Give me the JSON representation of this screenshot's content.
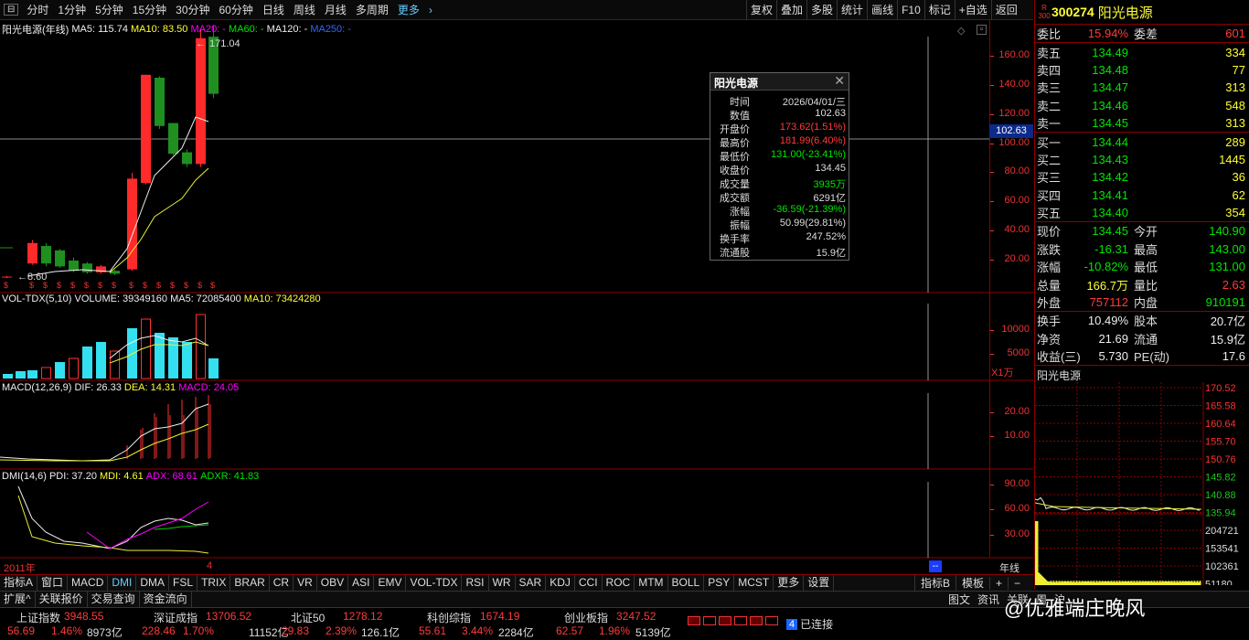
{
  "toolbar": {
    "periods": [
      "分时",
      "1分钟",
      "5分钟",
      "15分钟",
      "30分钟",
      "60分钟",
      "日线",
      "周线",
      "月线",
      "多周期"
    ],
    "more": "更多",
    "right": [
      "复权",
      "叠加",
      "多股",
      "统计",
      "画线",
      "F10",
      "标记",
      "+自选",
      "返回"
    ]
  },
  "main": {
    "title": "阳光电源(年线)",
    "ma5": "MA5: 115.74",
    "ma10": "MA10: 83.50",
    "ma20": "MA20: -",
    "ma60": "MA60: -",
    "ma120": "MA120: -",
    "ma250": "MA250: -",
    "high_label": "171.04",
    "low_label": "8.60",
    "axis": [
      "160.00",
      "140.00",
      "120.00",
      "100.00",
      "80.00",
      "60.00",
      "40.00",
      "20.00"
    ],
    "crosshair_value": "102.63"
  },
  "vol": {
    "title": "VOL-TDX(5,10)",
    "volume": "VOLUME: 39349160",
    "ma5": "MA5: 72085400",
    "ma10": "MA10: 73424280",
    "axis": [
      "10000",
      "5000"
    ],
    "unit": "X1万"
  },
  "macd": {
    "title": "MACD(12,26,9)",
    "dif": "DIF: 26.33",
    "dea": "DEA: 14.31",
    "macd": "MACD: 24.05",
    "axis": [
      "20.00",
      "10.00"
    ]
  },
  "dmi": {
    "title": "DMI(14,6)",
    "pdi": "PDI: 37.20",
    "mdi": "MDI: 4.61",
    "adx": "ADX: 68.61",
    "adxr": "ADXR: 41.83",
    "axis": [
      "90.00",
      "60.00",
      "30.00"
    ],
    "year": "2011年",
    "last_year": "4",
    "period_label": "年线"
  },
  "tooltip": {
    "title": "阳光电源",
    "rows": [
      [
        "时间",
        "2026/04/01/三"
      ],
      [
        "数值",
        "102.63"
      ],
      [
        "开盘价",
        "173.62(1.51%)"
      ],
      [
        "最高价",
        "181.99(6.40%)"
      ],
      [
        "最低价",
        "131.00(-23.41%)"
      ],
      [
        "收盘价",
        "134.45"
      ],
      [
        "成交量",
        "3935万"
      ],
      [
        "成交额",
        "6291亿"
      ],
      [
        "涨幅",
        "-36.59(-21.39%)"
      ],
      [
        "振幅",
        "50.99(29.81%)"
      ],
      [
        "换手率",
        "247.52%"
      ],
      [
        "流通股",
        "15.9亿"
      ]
    ]
  },
  "quote": {
    "code": "300274",
    "name": "阳光电源",
    "badge_top": "R",
    "badge_bot": "300",
    "weibi": [
      "委比",
      "15.94%",
      "委差",
      "601"
    ],
    "asks": [
      [
        "卖五",
        "134.49",
        "334"
      ],
      [
        "卖四",
        "134.48",
        "77"
      ],
      [
        "卖三",
        "134.47",
        "313"
      ],
      [
        "卖二",
        "134.46",
        "548"
      ],
      [
        "卖一",
        "134.45",
        "313"
      ]
    ],
    "bids": [
      [
        "买一",
        "134.44",
        "289"
      ],
      [
        "买二",
        "134.43",
        "1445"
      ],
      [
        "买三",
        "134.42",
        "36"
      ],
      [
        "买四",
        "134.41",
        "62"
      ],
      [
        "买五",
        "134.40",
        "354"
      ]
    ],
    "stats": [
      [
        "现价",
        "134.45",
        "今开",
        "140.90"
      ],
      [
        "涨跌",
        "-16.31",
        "最高",
        "143.00"
      ],
      [
        "涨幅",
        "-10.82%",
        "最低",
        "131.00"
      ],
      [
        "总量",
        "166.7万",
        "量比",
        "2.63"
      ],
      [
        "外盘",
        "757112",
        "内盘",
        "910191"
      ]
    ],
    "stats2": [
      [
        "换手",
        "10.49%",
        "股本",
        "20.7亿"
      ],
      [
        "净资",
        "21.69",
        "流通",
        "15.9亿"
      ],
      [
        "收益(三)",
        "5.730",
        "PE(动)",
        "17.6"
      ]
    ],
    "mini_title": "阳光电源",
    "mini_axis": [
      "170.52",
      "165.58",
      "160.64",
      "155.70",
      "150.76",
      "145.82",
      "140.88",
      "135.94",
      "204721",
      "153541",
      "102361",
      "51180"
    ]
  },
  "indicators": [
    "指标A",
    "窗口",
    "MACD",
    "DMI",
    "DMA",
    "FSL",
    "TRIX",
    "BRAR",
    "CR",
    "VR",
    "OBV",
    "ASI",
    "EMV",
    "VOL-TDX",
    "RSI",
    "WR",
    "SAR",
    "KDJ",
    "CCI",
    "ROC",
    "MTM",
    "BOLL",
    "PSY",
    "MCST",
    "更多",
    "设置"
  ],
  "indicators_right": [
    "指标B",
    "模板",
    "+",
    "−"
  ],
  "bar2": [
    "扩展^",
    "关联报价",
    "交易查询",
    "资金流向"
  ],
  "bar2_right": [
    "图文",
    "资讯",
    "关联",
    "周",
    "沪"
  ],
  "ticker": [
    {
      "name": "上证指数",
      "value": "3948.55",
      "chg": "56.69",
      "pct": "1.46%",
      "amt": "8973亿"
    },
    {
      "name": "深证成指",
      "value": "13706.52",
      "chg": "228.46",
      "pct": "1.70%",
      "amt": "11152亿"
    },
    {
      "name": "北证50",
      "value": "1278.12",
      "chg": "29.83",
      "pct": "2.39%",
      "amt": "126.1亿"
    },
    {
      "name": "科创综指",
      "value": "1674.19",
      "chg": "55.61",
      "pct": "3.44%",
      "amt": "2284亿"
    },
    {
      "name": "创业板指",
      "value": "3247.52",
      "chg": "62.57",
      "pct": "1.96%",
      "amt": "5139亿"
    }
  ],
  "connect": {
    "count": "4",
    "label": "已连接"
  },
  "watermark": "@优雅端庄晚风"
}
